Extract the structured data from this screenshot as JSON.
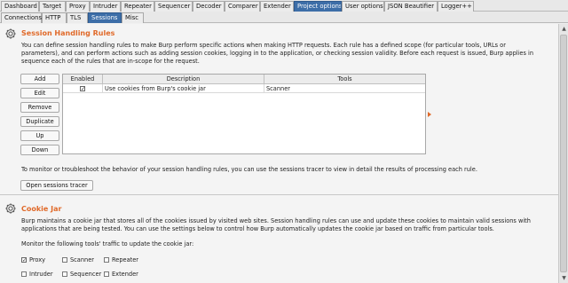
{
  "top_tabs": [
    "Dashboard",
    "Target",
    "Proxy",
    "Intruder",
    "Repeater",
    "Sequencer",
    "Decoder",
    "Comparer",
    "Extender",
    "Project options",
    "User options",
    "JSON Beautifier",
    "Logger++"
  ],
  "active_top_tab": "Project options",
  "sub_tabs": [
    "Connections",
    "HTTP",
    "TLS",
    "Sessions",
    "Misc"
  ],
  "active_sub_tab": "Sessions",
  "session_handling": {
    "title": "Session Handling Rules",
    "description": "You can define session handling rules to make Burp perform specific actions when making HTTP requests. Each rule has a defined scope (for particular tools, URLs or parameters), and can perform actions such as adding session cookies, logging in to the application, or checking session validity. Before each request is issued, Burp applies in sequence each of the rules that are in-scope for the request.",
    "buttons": [
      "Add",
      "Edit",
      "Remove",
      "Duplicate",
      "Up",
      "Down"
    ],
    "table": {
      "columns": [
        "Enabled",
        "Description",
        "Tools"
      ],
      "rows": [
        {
          "enabled": true,
          "description": "Use cookies from Burp's cookie jar",
          "tools": "Scanner"
        }
      ]
    },
    "tracer_text": "To monitor or troubleshoot the behavior of your session handling rules, you can use the sessions tracer to view in detail the results of processing each rule.",
    "tracer_button": "Open sessions tracer"
  },
  "cookie_jar": {
    "title": "Cookie Jar",
    "description": "Burp maintains a cookie jar that stores all of the cookies issued by visited web sites. Session handling rules can use and update these cookies to maintain valid sessions with applications that are being tested. You can use the settings below to control how Burp automatically updates the cookie jar based on traffic from particular tools.",
    "monitor_label": "Monitor the following tools' traffic to update the cookie jar:",
    "tools": [
      {
        "label": "Proxy",
        "checked": true
      },
      {
        "label": "Scanner",
        "checked": false
      },
      {
        "label": "Repeater",
        "checked": false
      },
      {
        "label": "Intruder",
        "checked": false
      },
      {
        "label": "Sequencer",
        "checked": false
      },
      {
        "label": "Extender",
        "checked": false
      }
    ]
  },
  "colors": {
    "accent": "#e06a2a",
    "active_tab": "#3d6ea8"
  },
  "icons": {
    "section": "gear-icon",
    "expand": "expand-arrow-icon"
  }
}
